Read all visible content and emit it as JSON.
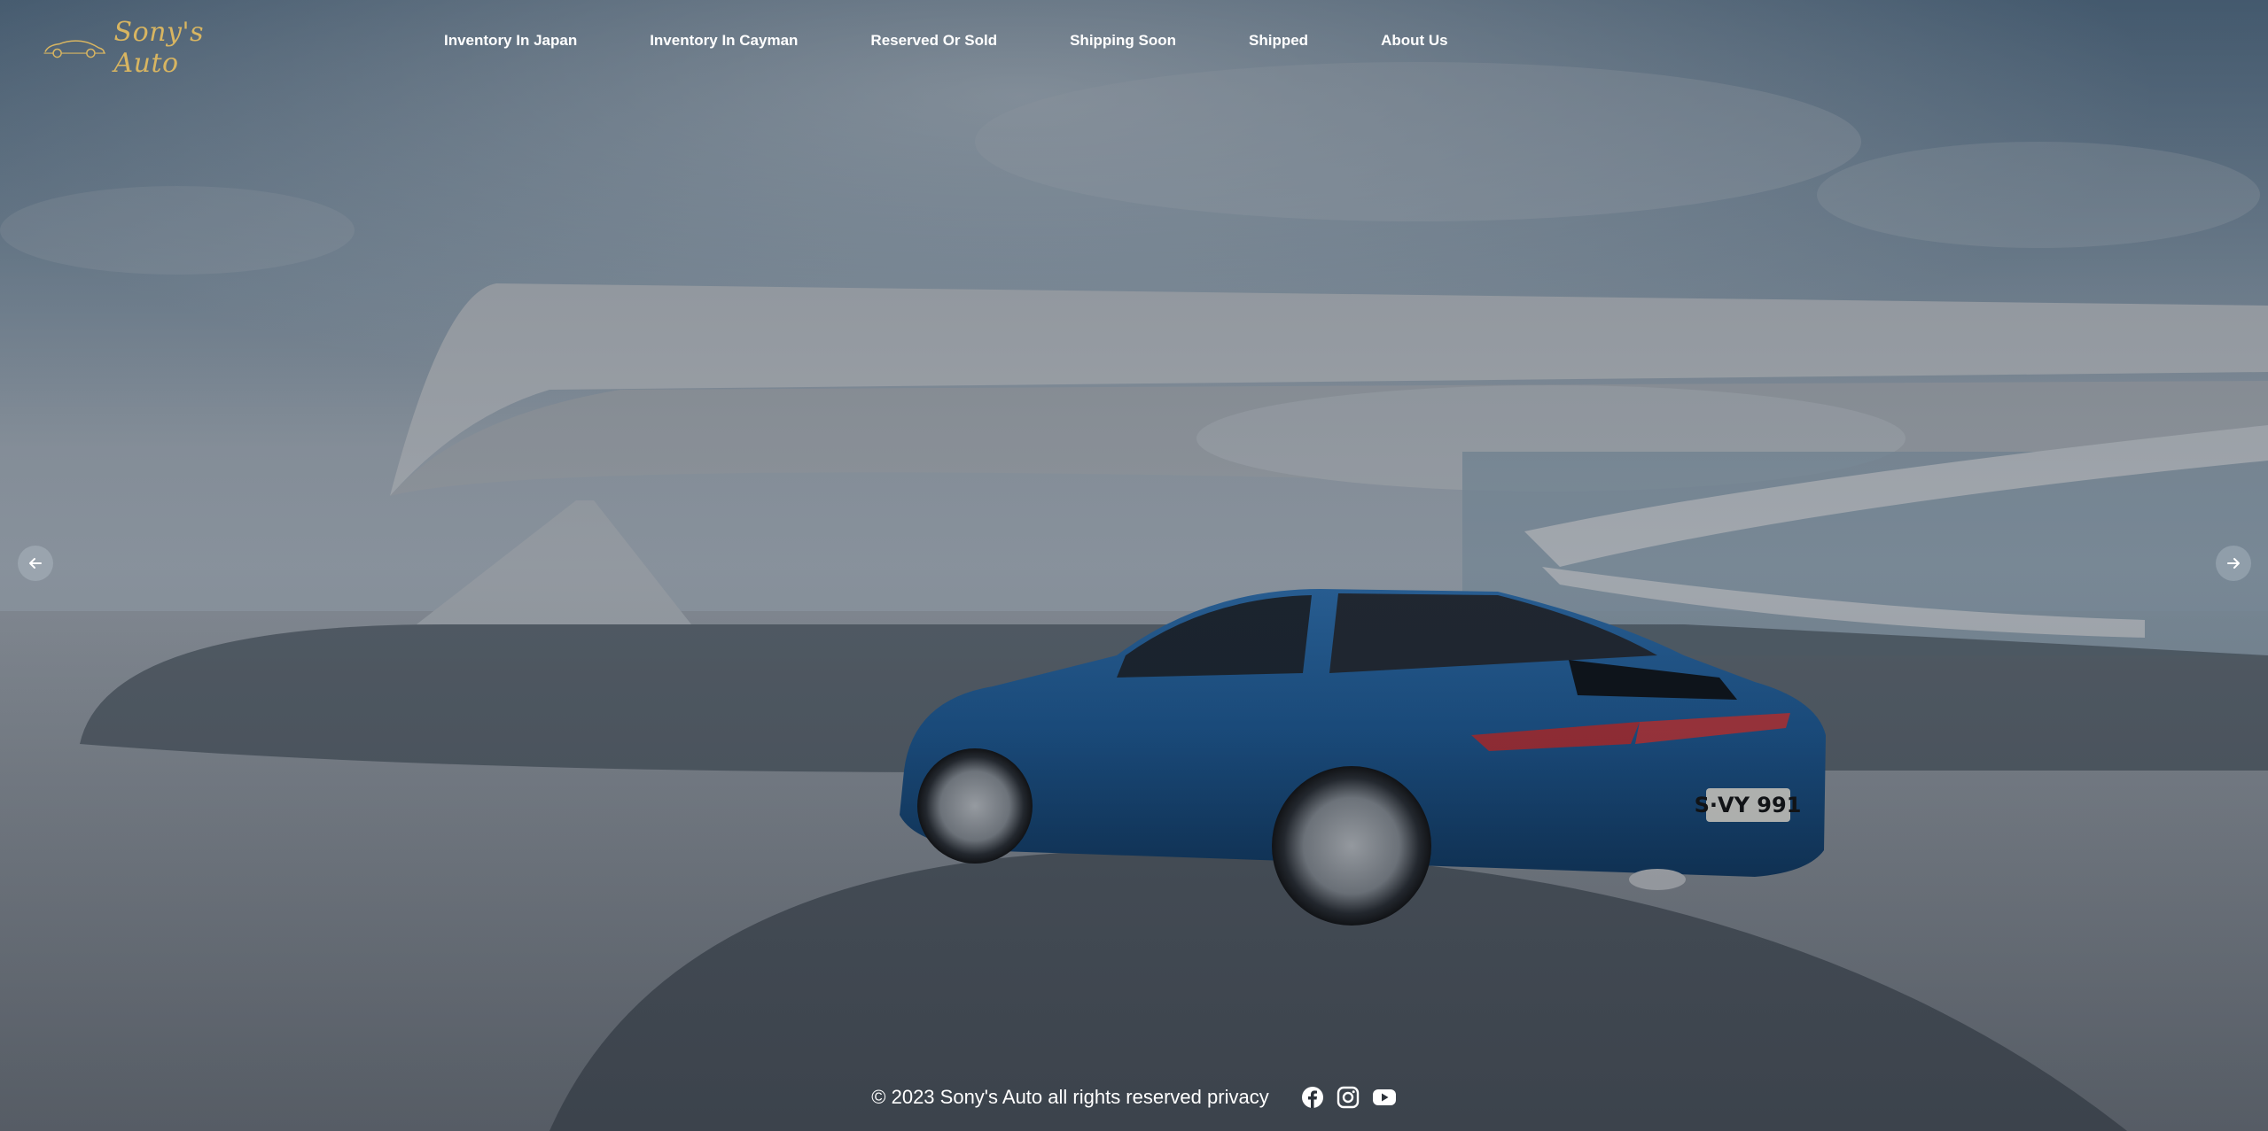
{
  "brand": {
    "logo_text": "Sony's Auto",
    "accent_color": "#d8b561"
  },
  "nav": {
    "items": [
      {
        "label": "Inventory In Japan"
      },
      {
        "label": "Inventory In Cayman"
      },
      {
        "label": "Reserved Or Sold"
      },
      {
        "label": "Shipping Soon"
      },
      {
        "label": "Shipped"
      },
      {
        "label": "About Us"
      }
    ]
  },
  "carousel": {
    "prev_icon": "arrow-left-icon",
    "next_icon": "arrow-right-icon",
    "license_plate": "S·VY 991"
  },
  "footer": {
    "text": "© 2023 Sony's Auto all rights reserved privacy",
    "social": [
      "facebook-icon",
      "instagram-icon",
      "youtube-icon"
    ]
  }
}
